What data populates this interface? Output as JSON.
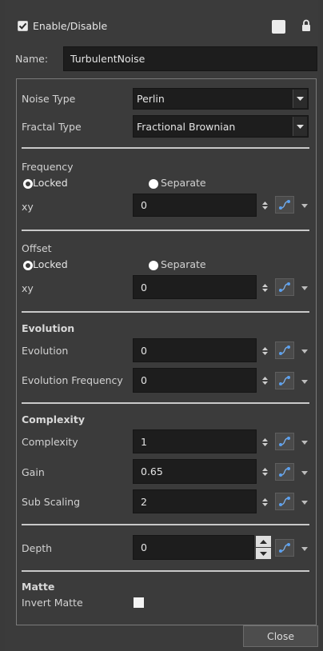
{
  "header": {
    "enable_label": "Enable/Disable",
    "enabled": true,
    "name_label": "Name:",
    "name_value": "TurbulentNoise"
  },
  "noise": {
    "type_label": "Noise Type",
    "type_value": "Perlin",
    "fractal_label": "Fractal Type",
    "fractal_value": "Fractional Brownian"
  },
  "frequency": {
    "title": "Frequency",
    "locked_label": "Locked",
    "separate_label": "Separate",
    "xy_label": "xy",
    "xy_value": "0"
  },
  "offset": {
    "title": "Offset",
    "locked_label": "Locked",
    "separate_label": "Separate",
    "xy_label": "xy",
    "xy_value": "0"
  },
  "evolution": {
    "title": "Evolution",
    "evolution_label": "Evolution",
    "evolution_value": "0",
    "frequency_label": "Evolution Frequency",
    "frequency_value": "0"
  },
  "complexity": {
    "title": "Complexity",
    "complexity_label": "Complexity",
    "complexity_value": "1",
    "gain_label": "Gain",
    "gain_value": "0.65",
    "subscaling_label": "Sub Scaling",
    "subscaling_value": "2"
  },
  "depth": {
    "label": "Depth",
    "value": "0"
  },
  "matte": {
    "title": "Matte",
    "invert_label": "Invert Matte",
    "invert_checked": false
  },
  "footer": {
    "close_label": "Close"
  }
}
